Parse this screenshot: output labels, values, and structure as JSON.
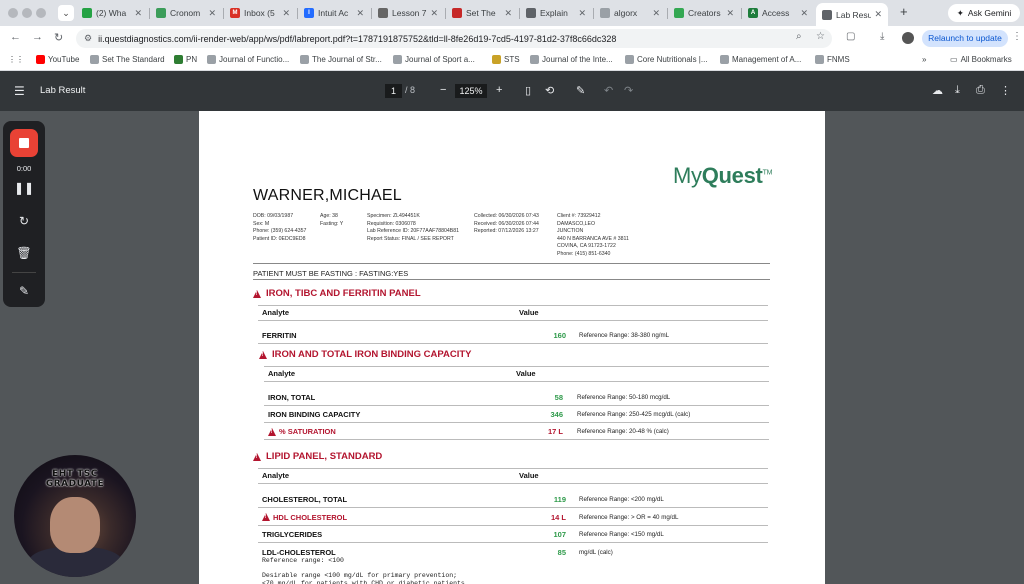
{
  "browser": {
    "tabs": [
      {
        "label": "(2) Wha",
        "fav_color": "#25a244",
        "fav_text": ""
      },
      {
        "label": "Cronom",
        "fav_color": "#3c9d5a",
        "fav_text": ""
      },
      {
        "label": "Inbox (5",
        "fav_color": "#d93025",
        "fav_text": "M"
      },
      {
        "label": "Intuit Ac",
        "fav_color": "#236cff",
        "fav_text": "I"
      },
      {
        "label": "Lesson 7",
        "fav_color": "#666666",
        "fav_text": ""
      },
      {
        "label": "Set The",
        "fav_color": "#c62828",
        "fav_text": ""
      },
      {
        "label": "Explain",
        "fav_color": "#5f6368",
        "fav_text": ""
      },
      {
        "label": "algorx",
        "fav_color": "#9aa0a6",
        "fav_text": ""
      },
      {
        "label": "Creators",
        "fav_color": "#34a853",
        "fav_text": ""
      },
      {
        "label": "Access",
        "fav_color": "#1e7d3c",
        "fav_text": "A"
      },
      {
        "label": "Lab Resu",
        "fav_color": "#5f6368",
        "fav_text": ""
      }
    ],
    "ask_gemini": "Ask Gemini",
    "url": "ii.questdiagnostics.com/ii-render-web/app/ws/pdf/labreport.pdf?t=1787191875752&tld=ll-8fe26d19-7cd5-4197-81d2-37f8c66dc328",
    "relaunch": "Relaunch to update",
    "bookmarks": [
      {
        "label": "YouTube",
        "color": "#ff0000"
      },
      {
        "label": "Set The Standard",
        "color": "#9aa0a6"
      },
      {
        "label": "PN",
        "color": "#2e7d32"
      },
      {
        "label": "Journal of Functio...",
        "color": "#9aa0a6"
      },
      {
        "label": "The Journal of Str...",
        "color": "#9aa0a6"
      },
      {
        "label": "Journal of Sport a...",
        "color": "#9aa0a6"
      },
      {
        "label": "STS",
        "color": "#c9a227"
      },
      {
        "label": "Journal of the Inte...",
        "color": "#9aa0a6"
      },
      {
        "label": "Core Nutritionals |...",
        "color": "#9aa0a6"
      },
      {
        "label": "Management of A...",
        "color": "#9aa0a6"
      },
      {
        "label": "FNMS",
        "color": "#9aa0a6"
      }
    ],
    "all_bookmarks": "All Bookmarks"
  },
  "pdf_toolbar": {
    "title": "Lab Result",
    "page_current": "1",
    "page_total": "/  8",
    "zoom": "125%"
  },
  "report": {
    "logo_light": "My",
    "logo_bold": "Quest",
    "logo_tm": "TM",
    "patient_name": "WARNER,MICHAEL",
    "patient_info": [
      "DOB: 09/03/1987",
      "Sex: M",
      "Phone: (359) 624-4357",
      "Patient ID: 0EDC9ED8"
    ],
    "patient_info2": [
      "Age: 38",
      "Fasting: Y"
    ],
    "specimen_info": [
      "Specimen: ZL494451K",
      "Requisition: 0306078",
      "Lab Reference ID: 20F77AAF78804B81",
      "Report Status: FINAL / SEE REPORT"
    ],
    "dates_info": [
      "Collected: 06/30/2026 07:43",
      "Received: 06/30/2026 07:44",
      "Reported: 07/12/2026 13:27"
    ],
    "client_info": [
      "Client #: 73929412",
      "DAMASCO,LEO",
      "JUNCTION",
      "440 N BARRANCA AVE # 3811",
      "COVINA, CA 91723-1722",
      "Phone: (415) 851-6340"
    ],
    "fasting_note": "PATIENT MUST BE FASTING : FASTING:YES",
    "col_analyte": "Analyte",
    "col_value": "Value",
    "panels": [
      {
        "title": "IRON, TIBC AND FERRITIN PANEL",
        "rows": [
          {
            "name": "FERRITIN",
            "value": "160",
            "ref": "Reference Range: 38-380 ng/mL",
            "abnormal": false
          }
        ]
      },
      {
        "title": "IRON AND TOTAL IRON BINDING CAPACITY",
        "rows": [
          {
            "name": "IRON, TOTAL",
            "value": "58",
            "ref": "Reference Range: 50-180 mcg/dL",
            "abnormal": false
          },
          {
            "name": "IRON BINDING CAPACITY",
            "value": "346",
            "ref": "Reference Range: 250-425 mcg/dL (calc)",
            "abnormal": false
          },
          {
            "name": "% SATURATION",
            "value": "17 L",
            "ref": "Reference Range: 20-48 % (calc)",
            "abnormal": true
          }
        ]
      },
      {
        "title": "LIPID PANEL, STANDARD",
        "rows": [
          {
            "name": "CHOLESTEROL, TOTAL",
            "value": "119",
            "ref": "Reference Range: <200 mg/dL",
            "abnormal": false
          },
          {
            "name": "HDL CHOLESTEROL",
            "value": "14 L",
            "ref": "Reference Range: > OR = 40 mg/dL",
            "abnormal": true
          },
          {
            "name": "TRIGLYCERIDES",
            "value": "107",
            "ref": "Reference Range: <150 mg/dL",
            "abnormal": false
          },
          {
            "name": "LDL-CHOLESTEROL",
            "value": "85",
            "ref": "mg/dL (calc)",
            "abnormal": false
          }
        ]
      }
    ],
    "ldl_notes": [
      "Reference range: <100",
      "",
      "Desirable range <100 mg/dL for primary prevention;",
      "<70 mg/dL for patients with CHD or diabetic patients"
    ]
  },
  "recorder": {
    "time": "0:00"
  },
  "webcam": {
    "overlay_text": "EHT TSC GRADUATE"
  },
  "colors": {
    "abnormal": "#b3152f",
    "normal_value": "#2e9a4a",
    "brand": "#2e7d5b"
  }
}
